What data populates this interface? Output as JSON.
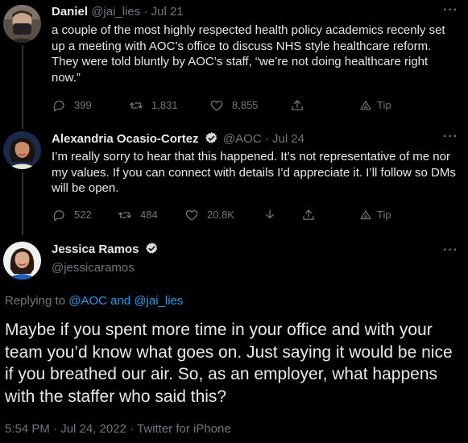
{
  "tweets": [
    {
      "name": "Daniel",
      "handle": "@jai_lies",
      "dot": "·",
      "date": "Jul 21",
      "text": "a couple of the most highly respected health policy academics recenly set up a meeting with AOC’s office to discuss NHS style healthcare reform. They were told bluntly by AOC’s staff, “we’re not doing healthcare right now.”",
      "replies": "399",
      "retweets": "1,831",
      "likes": "8,855",
      "tip": "Tip"
    },
    {
      "name": "Alexandria Ocasio-Cortez",
      "handle": "@AOC",
      "dot": "·",
      "date": "Jul 24",
      "text": "I’m really sorry to hear that this happened. It’s not representative of me nor my values. If you can connect with details I’d appreciate it. I’ll follow so DMs will be open.",
      "replies": "522",
      "retweets": "484",
      "likes": "20.8K",
      "tip": "Tip"
    }
  ],
  "main": {
    "name": "Jessica Ramos",
    "handle": "@jessicaramos",
    "replying_prefix": "Replying to ",
    "replying_to": "@AOC and @jai_lies",
    "text": "Maybe if you spent more time in your office and with your team you’d know what goes on. Just saying it would be nice if you breathed our air. So, as an employer, what happens with the staffer who said this?",
    "meta": "5:54 PM · Jul 24, 2022 · Twitter for iPhone"
  },
  "more_glyph": "···",
  "colors": {
    "background": "#000000",
    "text": "#e7e9ea",
    "muted": "#71767b",
    "link": "#1d9bf0",
    "verified": "#d9d9d9"
  }
}
